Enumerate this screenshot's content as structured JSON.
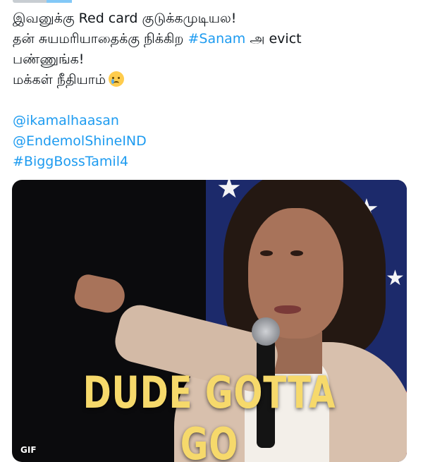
{
  "tweet": {
    "line1": "இவனுக்கு Red card குடுக்கமுடியல!",
    "line2_pre": "தன் சுயமரியாதைக்கு நிக்கிற ",
    "line2_tag": "#Sanam",
    "line2_post": " அ evict",
    "line3": "பண்ணுங்க!",
    "line4": "மக்கள் நீதியாம்",
    "emoji": "crying-face",
    "mentions": [
      "@ikamalhaasan",
      "@EndemolShineIND"
    ],
    "hashtag": "#BiggBossTamil4"
  },
  "media": {
    "caption": "DUDE GOTTA GO",
    "badge": "GIF"
  },
  "colors": {
    "link": "#1d9bf0",
    "text": "#0f1419",
    "caption": "#f6d96b"
  }
}
